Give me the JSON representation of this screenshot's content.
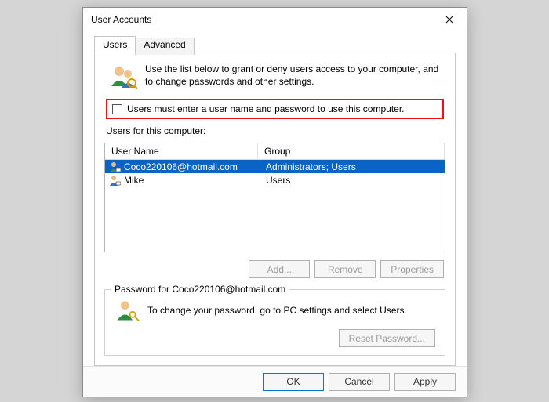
{
  "window": {
    "title": "User Accounts"
  },
  "tabs": {
    "users": "Users",
    "advanced": "Advanced"
  },
  "intro": "Use the list below to grant or deny users access to your computer, and to change passwords and other settings.",
  "checkbox_label": "Users must enter a user name and password to use this computer.",
  "list_label": "Users for this computer:",
  "columns": {
    "name": "User Name",
    "group": "Group"
  },
  "rows": [
    {
      "name": "Coco220106@hotmail.com",
      "group": "Administrators; Users",
      "selected": true
    },
    {
      "name": "Mike",
      "group": "Users",
      "selected": false
    }
  ],
  "buttons": {
    "add": "Add...",
    "remove": "Remove",
    "properties": "Properties",
    "reset": "Reset Password...",
    "ok": "OK",
    "cancel": "Cancel",
    "apply": "Apply"
  },
  "password_group_label": "Password for Coco220106@hotmail.com",
  "password_text": "To change your password, go to PC settings and select Users."
}
